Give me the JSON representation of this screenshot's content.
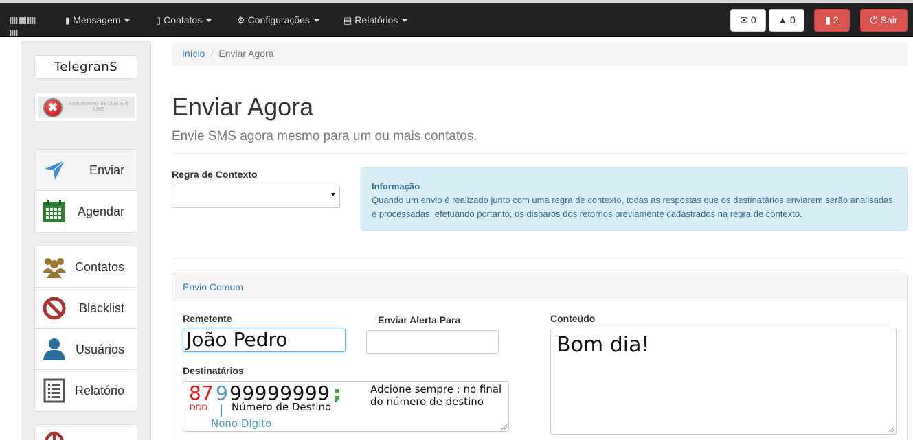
{
  "navbar": {
    "menus": [
      {
        "label": "Mensagem",
        "icon": "comment-icon"
      },
      {
        "label": "Contatos",
        "icon": "book-icon"
      },
      {
        "label": "Configurações",
        "icon": "gear-icon"
      },
      {
        "label": "Relatórios",
        "icon": "list-icon"
      }
    ],
    "messages_count": "0",
    "notifications_count": "0",
    "alerts_count": "2",
    "logout_label": "Sair"
  },
  "sidebar": {
    "brand": "TelegranS",
    "chat_status": "Atendimento via Chat OFF LINE",
    "group1": [
      {
        "label": "Enviar",
        "icon": "paper-plane-icon"
      },
      {
        "label": "Agendar",
        "icon": "calendar-icon"
      }
    ],
    "group2": [
      {
        "label": "Contatos",
        "icon": "users-icon"
      },
      {
        "label": "Blacklist",
        "icon": "ban-icon"
      },
      {
        "label": "Usuários",
        "icon": "user-icon"
      },
      {
        "label": "Relatório",
        "icon": "report-icon"
      }
    ]
  },
  "breadcrumb": {
    "home": "Início",
    "current": "Enviar Agora"
  },
  "page": {
    "title": "Enviar Agora",
    "subtitle": "Envie SMS agora mesmo para um ou mais contatos."
  },
  "context_rule": {
    "label": "Regra de Contexto",
    "value": ""
  },
  "info": {
    "title": "Informação",
    "text": "Quando um envio é realizado junto com uma regra de contexto, todas as respostas que os destinatários enviarem serão analisadas e processadas, efetuando portanto, os disparos dos retornos previamente cadastrados na regra de contexto."
  },
  "panel": {
    "title": "Envio Comum",
    "sender_label": "Remetente",
    "sender_value": "João Pedro",
    "alert_label": "Enviar Alerta Para",
    "alert_value": "",
    "content_label": "Conteúdo",
    "content_value": "Bom dia!",
    "recipients_label": "Destinatários",
    "recipients": {
      "ddd": "87",
      "ninth_digit": "9",
      "number": "99999999",
      "separator": ";",
      "ddd_label": "DDD",
      "number_label": "Número de Destino",
      "ninth_label": "Nono Dígito",
      "hint": "Adcione sempre ; no final do número de destino"
    }
  }
}
